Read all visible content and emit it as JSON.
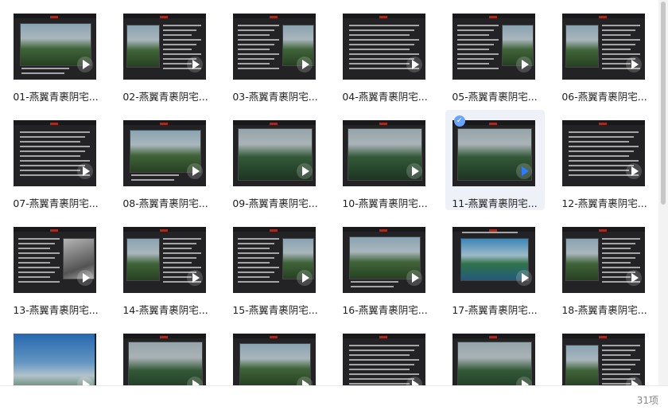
{
  "files": [
    {
      "name": "01-燕翼青裹阴宅...",
      "theme": "landscape",
      "selected": false
    },
    {
      "name": "02-燕翼青裹阴宅...",
      "theme": "text-photo",
      "selected": false
    },
    {
      "name": "03-燕翼青裹阴宅...",
      "theme": "text-photo",
      "selected": false
    },
    {
      "name": "04-燕翼青裹阴宅...",
      "theme": "text",
      "selected": false
    },
    {
      "name": "05-燕翼青裹阴宅...",
      "theme": "text-photo",
      "selected": false
    },
    {
      "name": "06-燕翼青裹阴宅...",
      "theme": "text-photo",
      "selected": false
    },
    {
      "name": "07-燕翼青裹阴宅...",
      "theme": "text",
      "selected": false
    },
    {
      "name": "08-燕翼青裹阴宅...",
      "theme": "landscape",
      "selected": false
    },
    {
      "name": "09-燕翼青裹阴宅...",
      "theme": "mountain",
      "selected": false
    },
    {
      "name": "10-燕翼青裹阴宅...",
      "theme": "mountain",
      "selected": false
    },
    {
      "name": "11-燕翼青裹阴宅...",
      "theme": "mountain",
      "selected": true
    },
    {
      "name": "12-燕翼青裹阴宅...",
      "theme": "text",
      "selected": false
    },
    {
      "name": "13-燕翼青裹阴宅...",
      "theme": "text-photo",
      "selected": false
    },
    {
      "name": "14-燕翼青裹阴宅...",
      "theme": "text-photo",
      "selected": false
    },
    {
      "name": "15-燕翼青裹阴宅...",
      "theme": "text-photo",
      "selected": false
    },
    {
      "name": "16-燕翼青裹阴宅...",
      "theme": "landscape",
      "selected": false
    },
    {
      "name": "17-燕翼青裹阴宅...",
      "theme": "lake",
      "selected": false
    },
    {
      "name": "18-燕翼青裹阴宅...",
      "theme": "text-photo",
      "selected": false
    },
    {
      "name": "",
      "theme": "sky",
      "selected": false
    },
    {
      "name": "",
      "theme": "mountain",
      "selected": false
    },
    {
      "name": "",
      "theme": "landscape",
      "selected": false
    },
    {
      "name": "",
      "theme": "text",
      "selected": false
    },
    {
      "name": "",
      "theme": "mountain",
      "selected": false
    },
    {
      "name": "",
      "theme": "text-photo",
      "selected": false
    }
  ],
  "footer": {
    "count": "31项"
  },
  "icons": {
    "play": "play-icon",
    "check": "check-icon"
  },
  "colors": {
    "selected_bg": "#eef1f8",
    "accent": "#2b7cff"
  }
}
